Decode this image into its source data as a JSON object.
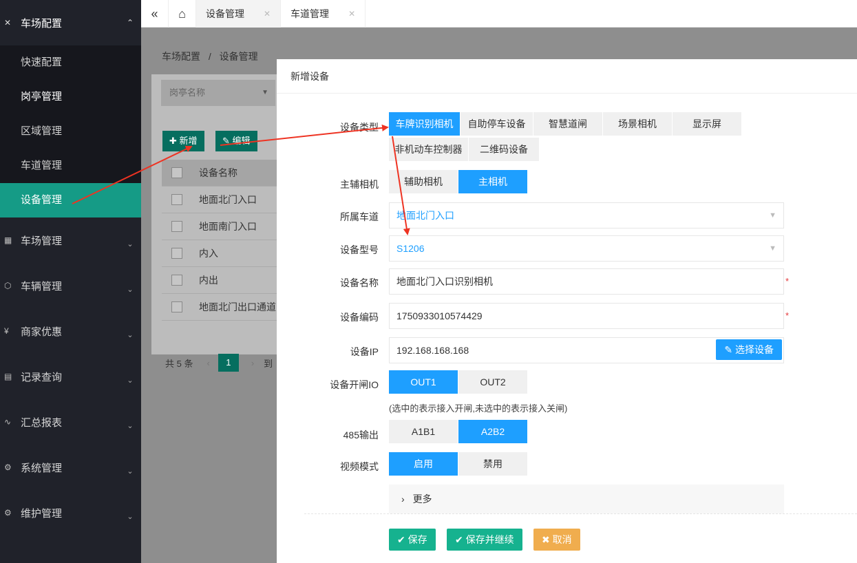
{
  "sidebar": {
    "top": {
      "label": "车场配置"
    },
    "sub_items": [
      "快速配置",
      "岗亭管理",
      "区域管理",
      "车道管理",
      "设备管理"
    ],
    "items": [
      "车场管理",
      "车辆管理",
      "商家优惠",
      "记录查询",
      "汇总报表",
      "系统管理",
      "维护管理"
    ]
  },
  "tabbar": {
    "tabs": [
      {
        "label": "设备管理"
      },
      {
        "label": "车道管理"
      }
    ]
  },
  "background": {
    "breadcrumb_root": "车场配置",
    "breadcrumb_sep": "/",
    "breadcrumb_current": "设备管理",
    "booth_placeholder": "岗亭名称",
    "add_label": "新增",
    "edit_label": "编辑",
    "col_name": "设备名称",
    "rows": [
      "地面北门入口",
      "地面南门入口",
      "内入",
      "内出",
      "地面北门出口通道"
    ],
    "total": "共 5 条",
    "page": "1",
    "goto": "到"
  },
  "dialog": {
    "title": "新增设备",
    "device_type": {
      "label": "设备类型",
      "options": [
        "车牌识别相机",
        "自助停车设备",
        "智慧道闸",
        "场景相机",
        "显示屏",
        "非机动车控制器",
        "二维码设备"
      ],
      "selected": "车牌识别相机"
    },
    "camera_role": {
      "label": "主辅相机",
      "options": [
        "辅助相机",
        "主相机"
      ],
      "selected": "主相机"
    },
    "lane": {
      "label": "所属车道",
      "value": "地面北门入口"
    },
    "model": {
      "label": "设备型号",
      "value": "S1206"
    },
    "name": {
      "label": "设备名称",
      "value": "地面北门入口识别相机",
      "required": "*"
    },
    "code": {
      "label": "设备编码",
      "value": "1750933010574429",
      "required": "*"
    },
    "ip": {
      "label": "设备IP",
      "value": "192.168.168.168",
      "choose_label": "选择设备"
    },
    "gate_io": {
      "label": "设备开闸IO",
      "options": [
        "OUT1",
        "OUT2"
      ],
      "selected": "OUT1",
      "hint": "(选中的表示接入开闸,未选中的表示接入关闸)"
    },
    "rs485": {
      "label": "485输出",
      "options": [
        "A1B1",
        "A2B2"
      ],
      "selected": "A2B2"
    },
    "video": {
      "label": "视频模式",
      "options": [
        "启用",
        "禁用"
      ],
      "selected": "启用"
    },
    "more_label": "更多",
    "actions": {
      "save": "保存",
      "save_continue": "保存并继续",
      "cancel": "取消"
    }
  },
  "colors": {
    "sidebar": "#20222a",
    "active": "#159b86",
    "primary": "#1e9fff",
    "success": "#16b28f",
    "warning": "#f0ad4e",
    "annotation": "#ee3322"
  }
}
